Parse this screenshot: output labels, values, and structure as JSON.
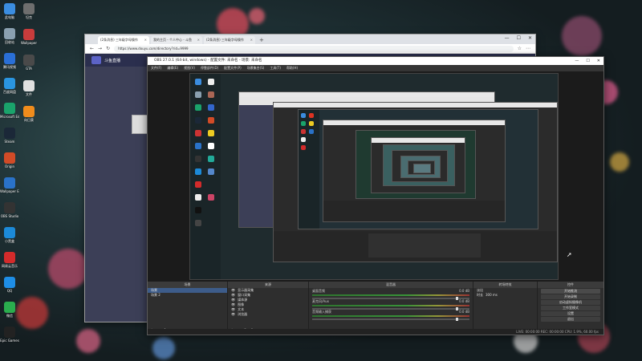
{
  "desktop": {
    "icons": [
      {
        "label": "此电脑",
        "color": "#3b8de0"
      },
      {
        "label": "回收站",
        "color": "#8aa0b0"
      },
      {
        "label": "腾讯视频",
        "color": "#2a6fd6"
      },
      {
        "label": "百度网盘",
        "color": "#2a95e0"
      },
      {
        "label": "Microsoft Edge",
        "color": "#1aa36b"
      },
      {
        "label": "Steam",
        "color": "#1b2838"
      },
      {
        "label": "Origin",
        "color": "#d14b27"
      },
      {
        "label": "Wallpaper Engine",
        "color": "#2a72c8"
      },
      {
        "label": "OBS Studio",
        "color": "#333"
      },
      {
        "label": "小黑盒",
        "color": "#1c8ad8"
      },
      {
        "label": "网易云音乐",
        "color": "#d32b2b"
      },
      {
        "label": "QQ",
        "color": "#1e8ee6"
      },
      {
        "label": "微信",
        "color": "#2aae4e"
      },
      {
        "label": "Epic Games",
        "color": "#222"
      }
    ],
    "extra_icons": [
      {
        "label": "坦克",
        "color": "#6e6e6e"
      },
      {
        "label": "Wallpaper",
        "color": "#c93c3c"
      },
      {
        "label": "GTA",
        "color": "#4a4a4a"
      },
      {
        "label": "文件",
        "color": "#e0e0e0"
      },
      {
        "label": "向日葵",
        "color": "#f08c1c"
      }
    ]
  },
  "browser": {
    "tabs": [
      {
        "label": "(2条消息) 三年级字母操作"
      },
      {
        "label": "我的主页 - 个人中心 - 斗鱼"
      },
      {
        "label": "(2条消息) 三年级字母操作"
      }
    ],
    "new_tab": "+",
    "url": "https://www.douyu.com/directory?rid=9999",
    "site_name": "斗鱼直播",
    "window_controls": [
      "—",
      "☐",
      "✕"
    ]
  },
  "obs": {
    "title": "OBS 27.0.1 (64-bit, windows) - 配置文件: 未命名 - 场景: 未命名",
    "menu": [
      "文件(F)",
      "编辑(E)",
      "视图(V)",
      "停靠部件(D)",
      "配置文件(P)",
      "场景集合(S)",
      "工具(T)",
      "帮助(H)"
    ],
    "window_controls": [
      "—",
      "☐",
      "✕"
    ],
    "dock_scenes": {
      "header": "场景",
      "items": [
        {
          "label": "场景",
          "selected": true
        },
        {
          "label": "场景 2",
          "selected": false
        }
      ]
    },
    "dock_sources": {
      "header": "来源",
      "items": [
        "显示器采集",
        "窗口采集",
        "媒体源",
        "图像",
        "文本",
        "浏览器"
      ]
    },
    "dock_mixer": {
      "header": "混音器",
      "channels": [
        {
          "name": "桌面音频",
          "db": "0.0 dB"
        },
        {
          "name": "麦克风/Aux",
          "db": "0.0 dB"
        },
        {
          "name": "音频输入捕获",
          "db": "0.0 dB"
        }
      ]
    },
    "dock_transitions": {
      "header": "转场特效",
      "type": "淡出",
      "duration_label": "时长",
      "duration_value": "300 ms"
    },
    "dock_controls": {
      "header": "控件",
      "buttons": [
        "开始推流",
        "开始录制",
        "启动虚拟摄像机",
        "工作室模式",
        "设置",
        "退出"
      ]
    },
    "status": "LIVE: 00:00:00   REC: 00:00:00   CPU: 1.9%, 60.00 fps",
    "scene_toolbar": "场景",
    "preview_label": "未选择源"
  },
  "colors": {
    "obs_bg": "#2b2b2b",
    "obs_dock": "#2e2e2e",
    "selection": "#3d5c8a"
  }
}
